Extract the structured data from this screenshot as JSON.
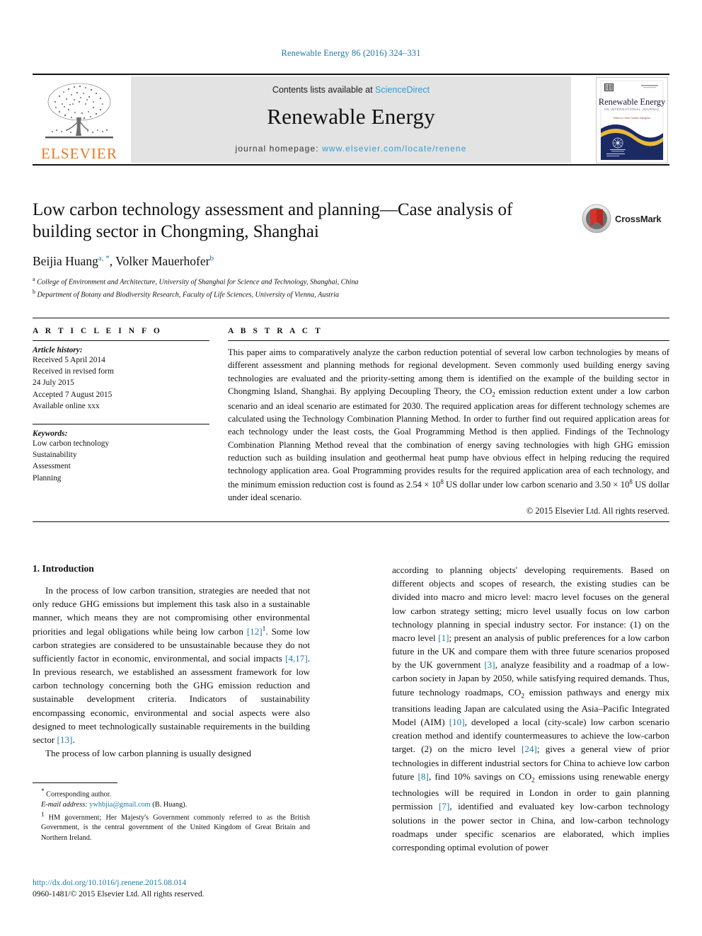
{
  "running_head": "Renewable Energy 86 (2016) 324–331",
  "masthead": {
    "publisher_name": "ELSEVIER",
    "contents_prefix": "Contents lists available at ",
    "contents_link": "ScienceDirect",
    "journal_title": "Renewable Energy",
    "homepage_prefix": "journal homepage: ",
    "homepage_url": "www.elsevier.com/locate/renene",
    "cover": {
      "title": "Renewable Energy",
      "subtitle": "AN INTERNATIONAL JOURNAL",
      "editor_line": "Editor-in-Chief: Soteris Kalogirou"
    }
  },
  "article": {
    "title": "Low carbon technology assessment and planning—Case analysis of building sector in Chongming, Shanghai",
    "authors": [
      {
        "name": "Beijia Huang",
        "marks": "a, *"
      },
      {
        "name": "Volker Mauerhofer",
        "marks": "b"
      }
    ],
    "affiliations": [
      {
        "mark": "a",
        "text": "College of Environment and Architecture, University of Shanghai for Science and Technology, Shanghai, China"
      },
      {
        "mark": "b",
        "text": "Department of Botany and Biodiversity Research, Faculty of Life Sciences, University of Vienna, Austria"
      }
    ],
    "crossmark_label": "CrossMark"
  },
  "article_info": {
    "heading": "A R T I C L E  I N F O",
    "history_label": "Article history:",
    "history": [
      "Received 5 April 2014",
      "Received in revised form",
      "24 July 2015",
      "Accepted 7 August 2015",
      "Available online xxx"
    ],
    "keywords_label": "Keywords:",
    "keywords": [
      "Low carbon technology",
      "Sustainability",
      "Assessment",
      "Planning"
    ]
  },
  "abstract": {
    "heading": "A B S T R A C T",
    "part1": "This paper aims to comparatively analyze the carbon reduction potential of several low carbon technologies by means of different assessment and planning methods for regional development. Seven commonly used building energy saving technologies are evaluated and the priority-setting among them is identified on the example of the building sector in Chongming Island, Shanghai. By applying Decoupling Theory, the CO",
    "sub1": "2",
    "part2": " emission reduction extent under a low carbon scenario and an ideal scenario are estimated for 2030. The required application areas for different technology schemes are calculated using the Technology Combination Planning Method. In order to further find out required application areas for each technology under the least costs, the Goal Programming Method is then applied. Findings of the Technology Combination Planning Method reveal that the combination of energy saving technologies with high GHG emission reduction such as building insulation and geothermal heat pump have obvious effect in helping reducing the required technology application area. Goal Programming provides results for the required application area of each technology, and the minimum emission reduction cost is found as 2.54 × 10",
    "sup1": "8",
    "part3": " US dollar under low carbon scenario and 3.50 × 10",
    "sup2": "8",
    "part4": " US dollar under ideal scenario.",
    "copyright": "© 2015 Elsevier Ltd. All rights reserved."
  },
  "body": {
    "section_heading": "1. Introduction",
    "left_para_1_a": "In the process of low carbon transition, strategies are needed that not only reduce GHG emissions but implement this task also in a sustainable manner, which means they are not compromising other environmental priorities and legal obligations while being low carbon ",
    "left_cite_1": "[12]",
    "left_para_1_fn": "1",
    "left_para_1_b": ". Some low carbon strategies are considered to be unsustainable because they do not sufficiently factor in economic, environmental, and social impacts ",
    "left_cite_2": "[4,17]",
    "left_para_1_c": ". In previous research, we established an assessment framework for low carbon technology concerning both the GHG emission reduction and sustainable development criteria. Indicators of sustainability encompassing economic, environmental and social aspects were also designed to meet technologically sustainable requirements in the building sector ",
    "left_cite_3": "[13]",
    "left_para_1_d": ".",
    "left_para_2": "The process of low carbon planning is usually designed",
    "right_para_a": "according to planning objects' developing requirements. Based on different objects and scopes of research, the existing studies can be divided into macro and micro level: macro level focuses on the general low carbon strategy setting; micro level usually focus on low carbon technology planning in special industry sector. For instance: (1) on the macro level ",
    "right_cite_1": "[1]",
    "right_para_b": "; present an analysis of public preferences for a low carbon future in the UK and compare them with three future scenarios proposed by the UK government ",
    "right_cite_2": "[3]",
    "right_para_c": ", analyze feasibility and a roadmap of a low-carbon society in Japan by 2050, while satisfying required demands. Thus, future technology roadmaps, CO",
    "right_sub_1": "2",
    "right_para_d": " emission pathways and energy mix transitions leading Japan are calculated using the Asia–Pacific Integrated Model (AIM) ",
    "right_cite_3": "[10]",
    "right_para_e": ", developed a local (city-scale) low carbon scenario creation method and identify countermeasures to achieve the low-carbon target. (2) on the micro level ",
    "right_cite_4": "[24]",
    "right_para_f": "; gives a general view of prior technologies in different industrial sectors for China to achieve low carbon future ",
    "right_cite_5": "[8]",
    "right_para_g": ", find 10% savings on CO",
    "right_sub_2": "2",
    "right_para_h": " emissions using renewable energy technologies will be required in London in order to gain planning permission ",
    "right_cite_6": "[7]",
    "right_para_i": ", identified and evaluated key low-carbon technology solutions in the power sector in China, and low-carbon technology roadmaps under specific scenarios are elaborated, which implies corresponding optimal evolution of power"
  },
  "footnotes": {
    "corresponding_mark": "*",
    "corresponding_label": "Corresponding author.",
    "email_label": "E-mail address:",
    "email": "ywhbjia@gmail.com",
    "email_owner": "(B. Huang).",
    "fn1_mark": "1",
    "fn1_text": "HM government; Her Majesty's Government commonly referred to as the British Government, is the central government of the United Kingdom of Great Britain and Northern Ireland."
  },
  "footer": {
    "doi": "http://dx.doi.org/10.1016/j.renene.2015.08.014",
    "issn_line": "0960-1481/© 2015 Elsevier Ltd. All rights reserved."
  }
}
